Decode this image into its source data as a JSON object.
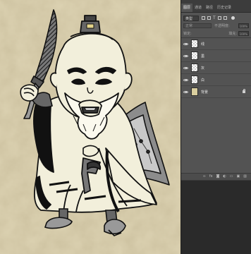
{
  "panel": {
    "tabs": [
      {
        "label": "图层",
        "active": true
      },
      {
        "label": "通道",
        "active": false
      },
      {
        "label": "路径",
        "active": false
      },
      {
        "label": "历史记录",
        "active": false
      }
    ],
    "filter": {
      "kind_label": "类型"
    },
    "blend": {
      "mode": "正常",
      "opacity_label": "不透明度:",
      "opacity_value": "100%"
    },
    "lock": {
      "label": "锁定:",
      "fill_label": "填充:",
      "fill_value": "100%"
    },
    "layers": [
      {
        "name": "线",
        "type": "transparent",
        "visible": true,
        "locked": false
      },
      {
        "name": "墨",
        "type": "transparent",
        "visible": true,
        "locked": false
      },
      {
        "name": "灰",
        "type": "transparent",
        "visible": true,
        "locked": false
      },
      {
        "name": "白",
        "type": "transparent",
        "visible": true,
        "locked": false
      },
      {
        "name": "背景",
        "type": "background",
        "visible": true,
        "locked": true
      }
    ],
    "bottom_icons": [
      "link-icon",
      "fx-icon",
      "mask-icon",
      "adjustment-icon",
      "group-folder-icon",
      "new-layer-icon",
      "trash-icon"
    ]
  },
  "colors": {
    "parchment": "#ddd3b3",
    "panel_bg": "#535353",
    "panel_dark": "#2a2a2a",
    "ink": "#111111",
    "robe_white": "#f2efdb",
    "gray_fill": "#8a8a8a"
  }
}
